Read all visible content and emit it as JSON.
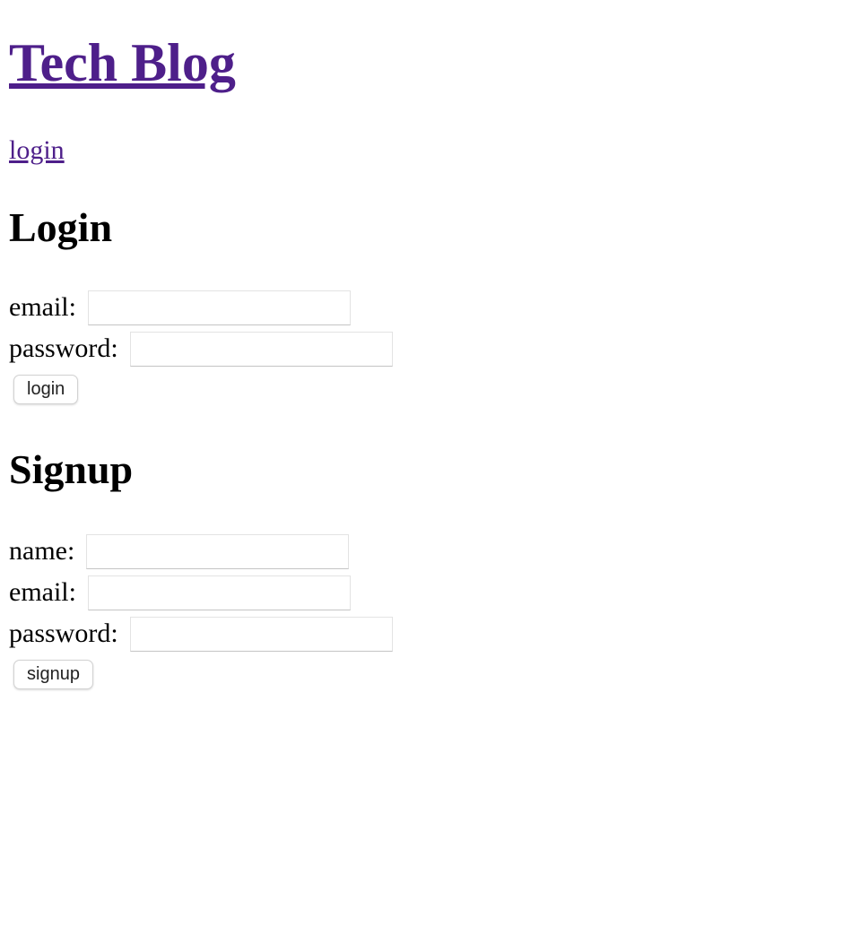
{
  "header": {
    "title": "Tech Blog",
    "nav_login": "login"
  },
  "login": {
    "heading": "Login",
    "email_label": "email:",
    "password_label": "password:",
    "email_value": "",
    "password_value": "",
    "button": "login"
  },
  "signup": {
    "heading": "Signup",
    "name_label": "name:",
    "email_label": "email:",
    "password_label": "password:",
    "name_value": "",
    "email_value": "",
    "password_value": "",
    "button": "signup"
  }
}
